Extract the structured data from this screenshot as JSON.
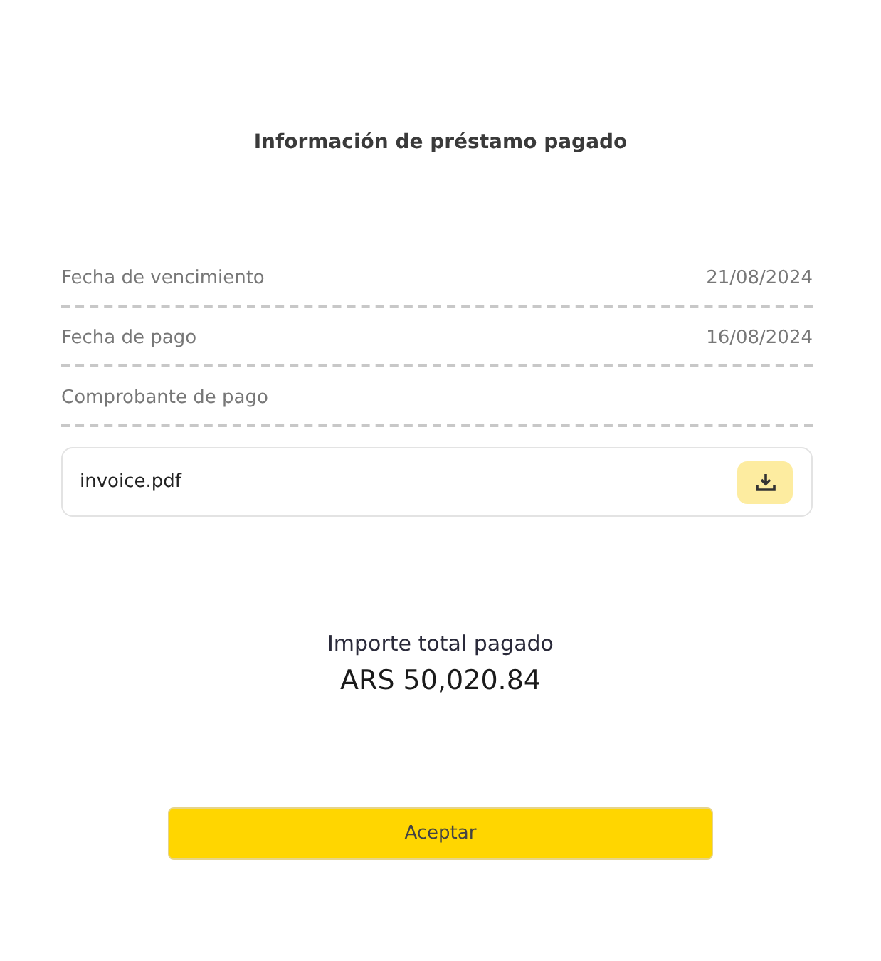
{
  "title": "Información de préstamo pagado",
  "rows": [
    {
      "label": "Fecha de vencimiento",
      "value": "21/08/2024"
    },
    {
      "label": "Fecha de pago",
      "value": "16/08/2024"
    },
    {
      "label": "Comprobante de pago"
    }
  ],
  "attachment": {
    "file_name": "invoice.pdf"
  },
  "total": {
    "label": "Importe total pagado",
    "amount": "ARS 50,020.84"
  },
  "buttons": [
    "Aceptar"
  ]
}
